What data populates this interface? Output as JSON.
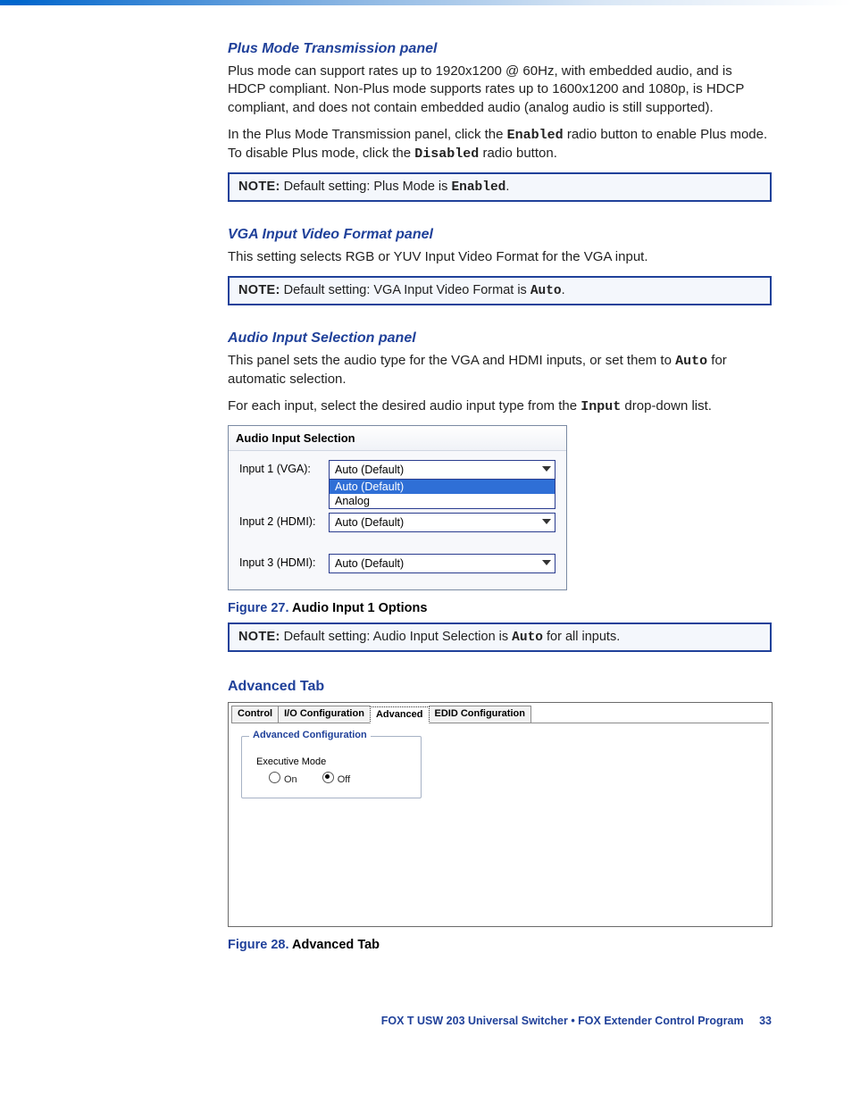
{
  "sections": {
    "plus": {
      "heading": "Plus Mode Transmission panel",
      "p1a": "Plus mode can support rates up to 1920x1200 @ 60Hz, with embedded audio, and is HDCP compliant. Non-Plus mode supports rates up to 1600x1200 and 1080p, is HDCP compliant, and does not contain embedded audio (analog audio is still supported).",
      "p2_pre": "In the Plus Mode Transmission panel, click the ",
      "p2_code1": "Enabled",
      "p2_mid": " radio button to enable Plus mode. To disable Plus mode, click the ",
      "p2_code2": "Disabled",
      "p2_post": " radio button.",
      "note_label": "NOTE:",
      "note_pre": "   Default setting: Plus Mode is ",
      "note_code": "Enabled",
      "note_post": "."
    },
    "vga": {
      "heading": "VGA Input Video Format panel",
      "p1": "This setting selects RGB or YUV Input Video Format for the VGA input.",
      "note_label": "NOTE:",
      "note_pre": "   Default setting: VGA Input Video Format is ",
      "note_code": "Auto",
      "note_post": "."
    },
    "audio": {
      "heading": "Audio Input Selection panel",
      "p1_pre": "This panel sets the audio type for the VGA and HDMI inputs, or set them to ",
      "p1_code": "Auto",
      "p1_post": " for automatic selection.",
      "p2_pre": "For each input, select the desired audio input type from the ",
      "p2_code": "Input",
      "p2_post": " drop-down list.",
      "panel_title": "Audio Input Selection",
      "rows": {
        "r1_label": "Input 1 (VGA):",
        "r1_value": "Auto (Default)",
        "r1_opt_selected": "Auto (Default)",
        "r1_opt2": "Analog",
        "r2_label": "Input 2 (HDMI):",
        "r2_value": "Auto (Default)",
        "r3_label": "Input 3 (HDMI):",
        "r3_value": "Auto (Default)"
      },
      "fig_num": "Figure 27.",
      "fig_title": "  Audio Input 1 Options",
      "note_label": "NOTE:",
      "note_pre": "   Default setting: Audio Input Selection is ",
      "note_code": "Auto",
      "note_post": " for all inputs."
    },
    "advanced": {
      "heading": "Advanced Tab",
      "tabs": {
        "t1": "Control",
        "t2": "I/O Configuration",
        "t3": "Advanced",
        "t4": "EDID Configuration"
      },
      "group_legend": "Advanced Configuration",
      "sub_title": "Executive Mode",
      "opt_on": "On",
      "opt_off": "Off",
      "fig_num": "Figure 28.",
      "fig_title": "  Advanced Tab"
    }
  },
  "footer": {
    "title": "FOX T USW 203 Universal Switcher • FOX Extender Control Program",
    "page": "33"
  }
}
